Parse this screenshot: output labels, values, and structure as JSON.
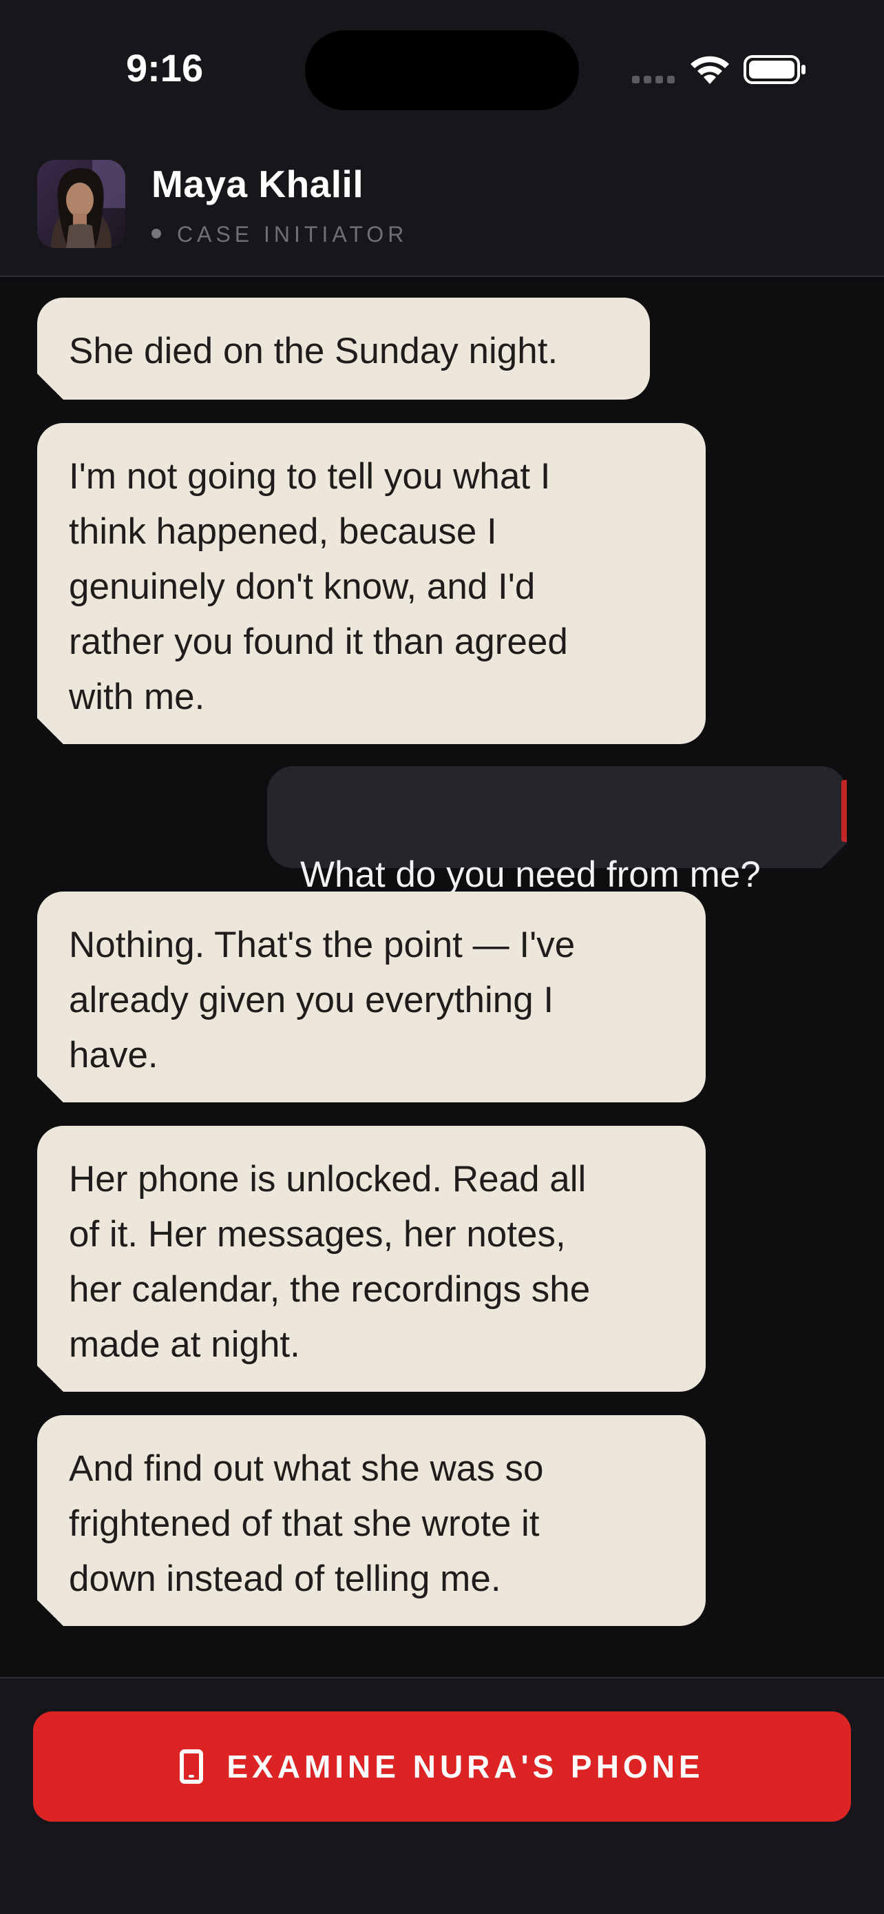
{
  "status_bar": {
    "time": "9:16"
  },
  "header": {
    "name": "Maya Khalil",
    "role": "CASE INITIATOR",
    "avatar_icon": "person-portrait"
  },
  "messages": [
    {
      "from": "contact",
      "text": "She died on the Sunday night."
    },
    {
      "from": "contact",
      "text": "I'm not going to tell you what I\nthink happened, because I\ngenuinely don't know, and I'd\nrather you found it than agreed\nwith me."
    },
    {
      "from": "me",
      "text": "What do you need from me?"
    },
    {
      "from": "contact",
      "text": "Nothing. That's the point — I've\nalready given you everything I\nhave."
    },
    {
      "from": "contact",
      "text": "Her phone is unlocked. Read all\nof it. Her messages, her notes,\nher calendar, the recordings she\nmade at night."
    },
    {
      "from": "contact",
      "text": "And find out what she was so\nfrightened of that she wrote it\ndown instead of telling me."
    }
  ],
  "footer": {
    "cta_label": "EXAMINE NURA'S PHONE",
    "cta_icon": "phone-icon",
    "cta_color": "#dd2424"
  },
  "colors": {
    "background": "#0e0e11",
    "incoming_bubble": "#ede7db",
    "outgoing_bubble": "#25262c",
    "accent": "#c32626"
  }
}
